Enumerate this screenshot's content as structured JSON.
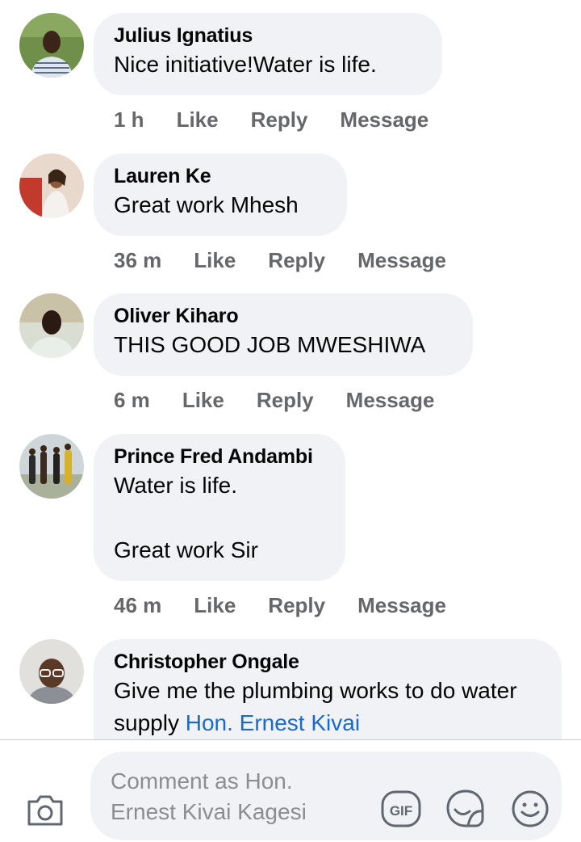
{
  "comments": [
    {
      "author": "Julius Ignatius",
      "text": "Nice initiative!Water is life.",
      "mention": "",
      "time": "1 h",
      "avatar_icon": "avatar-photo-man-striped-shirt"
    },
    {
      "author": "Lauren Ke",
      "text": "Great work Mhesh",
      "mention": "",
      "time": "36 m",
      "avatar_icon": "avatar-photo-woman-seated"
    },
    {
      "author": "Oliver Kiharo",
      "text": "THIS GOOD JOB MWESHIWA",
      "mention": "",
      "time": "6 m",
      "avatar_icon": "avatar-photo-man-portrait"
    },
    {
      "author": "Prince Fred Andambi",
      "text": "Water is life.\n\nGreat work Sir",
      "mention": "",
      "time": "46 m",
      "avatar_icon": "avatar-photo-group-outdoors"
    },
    {
      "author": "Christopher Ongale",
      "text": "Give me the plumbing works to do water supply ",
      "mention": "Hon. Ernest Kivai",
      "time": "",
      "avatar_icon": "avatar-photo-elderly-man-glasses"
    }
  ],
  "actions": {
    "like": "Like",
    "reply": "Reply",
    "message": "Message"
  },
  "composer": {
    "placeholder": "Comment as Hon. Ernest Kivai Kagesi",
    "camera_icon": "camera-icon",
    "gif_label": "GIF",
    "sticker_icon": "sticker-icon",
    "emoji_icon": "emoji-icon"
  },
  "colors": {
    "bubble": "#f0f2f5",
    "meta": "#65676b",
    "mention": "#1b6ac9",
    "placeholder": "#8a8d91"
  }
}
